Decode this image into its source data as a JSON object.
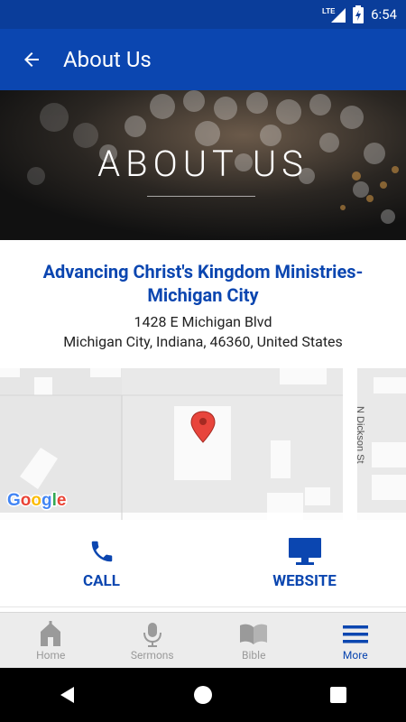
{
  "status_bar": {
    "network": "LTE",
    "time": "6:54"
  },
  "app_bar": {
    "title": "About Us"
  },
  "hero": {
    "title": "ABOUT US"
  },
  "church": {
    "name": "Advancing Christ's Kingdom Ministries-Michigan City",
    "address_line1": "1428 E Michigan Blvd",
    "address_line2": "Michigan City, Indiana, 46360, United States"
  },
  "map": {
    "street_label": "N Dickson St",
    "brand": "Google"
  },
  "actions": [
    {
      "label": "CALL",
      "icon": "phone-icon"
    },
    {
      "label": "WEBSITE",
      "icon": "monitor-icon"
    }
  ],
  "tabs": [
    {
      "label": "Home",
      "icon": "home-icon",
      "active": false
    },
    {
      "label": "Sermons",
      "icon": "microphone-icon",
      "active": false
    },
    {
      "label": "Bible",
      "icon": "book-icon",
      "active": false
    },
    {
      "label": "More",
      "icon": "menu-icon",
      "active": true
    }
  ],
  "colors": {
    "primary": "#0b46b0",
    "status_bar": "#0a3d9a",
    "tab_inactive": "#9a9a9a"
  }
}
